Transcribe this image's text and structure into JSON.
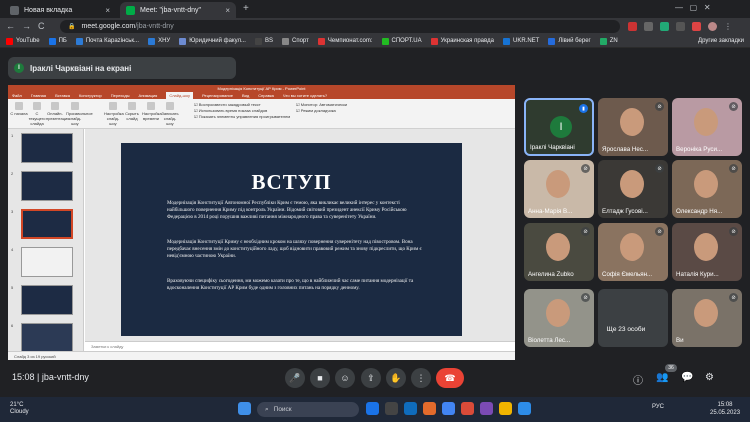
{
  "browser": {
    "tabs": [
      {
        "title": "Новая вкладка",
        "close": "×"
      },
      {
        "title": "Meet: \"jba-vntt-dny\"",
        "close": "×"
      }
    ],
    "new_tab": "+",
    "nav": {
      "back": "←",
      "forward": "→",
      "reload": "C"
    },
    "url_host": "meet.google.com",
    "url_path": "/jba-vntt-dny",
    "bookmarks": [
      "YouTube",
      "ПБ",
      "Почта Карazінськ...",
      "ХНУ",
      "Юридичний факул...",
      "BS",
      "Спорт",
      "Чемпионат.com:",
      "СПОРТ.UA",
      "Украинская правда",
      "UKR.NET",
      "Лівий берег",
      "ZN"
    ],
    "other_bookmarks": "Другие закладки",
    "bookmark_colors": [
      "#ff0000",
      "#1a73e8",
      "#2d7bd6",
      "#2b7ad6",
      "#6d8bd2",
      "#444",
      "#888",
      "#d33",
      "#2b2",
      "#d33",
      "#1673d4",
      "#256bdc",
      "#2a6"
    ]
  },
  "meet": {
    "presenter_initial": "I",
    "presenter_banner": "Іраклі Чарквіані на екрані",
    "meeting_code": "15:08  |  jba-vntt-dny",
    "participant_count": "36",
    "controls": {
      "mic": "🎤",
      "cam": "■",
      "cc": "☺",
      "present": "⇪",
      "hand": "✋",
      "more": "⋮",
      "end": "☎"
    },
    "right_controls": {
      "info": "ⓘ",
      "people": "👥",
      "chat": "💬",
      "activities": "⚙"
    },
    "tiles": [
      {
        "name": "Іраклі Чарквіані",
        "initial": "I",
        "mic": "on",
        "bg": "#2f3b2f"
      },
      {
        "name": "Ярослава Нес...",
        "mic": "off",
        "bg": "#6d5a4d"
      },
      {
        "name": "Вероніка Руси...",
        "mic": "off",
        "bg": "#b99aa3"
      },
      {
        "name": "Анна-Марія В...",
        "mic": "off",
        "bg": "#c9b9a8"
      },
      {
        "name": "Елтадж Гусові...",
        "mic": "off",
        "bg": "#3b3936"
      },
      {
        "name": "Олександр Ня...",
        "mic": "off",
        "bg": "#7c6857"
      },
      {
        "name": "Ангелина Zubko",
        "mic": "off",
        "bg": "#4a4a40"
      },
      {
        "name": "Софія Ємельян...",
        "mic": "off",
        "bg": "#8a7360"
      },
      {
        "name": "Наталія Кури...",
        "mic": "off",
        "bg": "#5a4a45"
      },
      {
        "name": "Віолетта Лес...",
        "mic": "off",
        "bg": "#93938a"
      },
      {
        "name": "Ще 23 особи",
        "mic": "",
        "bg": "#3c4043"
      },
      {
        "name": "Ви",
        "mic": "off",
        "bg": "#7a7268"
      }
    ]
  },
  "powerpoint": {
    "title": "Модернізація Конституції АР Крим  -  PowerPoint",
    "tabs": [
      "Файл",
      "Главная",
      "Вставка",
      "Конструктор",
      "Переходы",
      "Анимация",
      "Слайд-шоу",
      "Рецензирование",
      "Вид",
      "Справка",
      "Что вы хотите сделать?"
    ],
    "ribbon_buttons": [
      "С начала",
      "С текущего слайда",
      "Онлайн-презентация",
      "Произвольное слайд-шоу",
      "Настройка слайд-шоу",
      "Скрыть слайд",
      "Настройка времени",
      "Записать слайд-шоу"
    ],
    "ribbon_checks": [
      "Воспроизвести закадровый текст",
      "Использовать время показа слайдов",
      "Показать элементы управления проигрывателем",
      "Монитор: Автоматически",
      "Режим докладчика"
    ],
    "notes_placeholder": "Заметки к слайду",
    "status": "Слайд 3 из 19    русский",
    "slide_numbers": [
      "1",
      "2",
      "3",
      "4",
      "5",
      "6"
    ],
    "slide": {
      "title": "ВСТУП",
      "paragraphs": [
        "Модернізація Конституції Автономної Республіки Крим є темою, яка викликає великий інтерес у контексті найбільшого повернення Криму під контроль України. Відомий світовий президент анексії Криму Російською Федерацією в 2014 році порушив важливі питання міжнародного права та суверенітету України.",
        "Модернізація Конституції Криму є необхідним кроком на шляху повернення суверенітету над півостровом. Вона передбачає внесення змін до конституційного ладу, щоб відновити правовий режим та знову підкреслити, що Крим є невід'ємною частиною України.",
        "Враховуючи специфіку сьогодення, ми можемо казати про те, що в найближчий час саме питання модернізації та вдосконалення Конституції АР Крим буде одним з головних питань на порядку денному."
      ]
    }
  },
  "taskbar": {
    "weather_temp": "21°C",
    "weather_desc": "Cloudy",
    "search": "Поиск",
    "lang": "РУС",
    "time": "15:08",
    "date": "25.05.2023",
    "app_colors": [
      "#1a73e8",
      "#444",
      "#0f6cbd",
      "#e36b2c",
      "#4285f4",
      "#d94b39",
      "#7b4bb5",
      "#f0b400",
      "#2d8ce8"
    ]
  }
}
